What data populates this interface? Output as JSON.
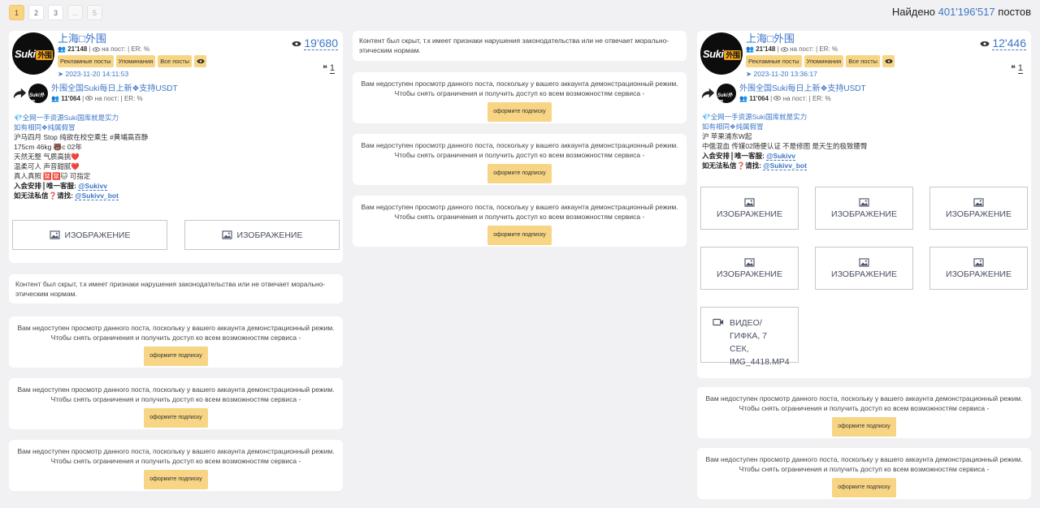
{
  "pagination": {
    "pages": [
      "1",
      "2",
      "3",
      "...",
      "5"
    ],
    "active": "1"
  },
  "found": {
    "prefix": "Найдено",
    "count": "401'196'517",
    "suffix": "постов"
  },
  "hidden_text": "Контент был скрыт, т.к имеет признаки нарушения законодательства или не отвечает морально-этическим нормам.",
  "demo": {
    "line1": "Вам недоступен просмотр данного поста, поскольку у вашего аккаунта демонстрационный режим.",
    "line2": "Чтобы снять ограничения и получить доступ ко всем возможностям сервиса -",
    "button": "оформите подписку"
  },
  "tags": {
    "ads": "Рекламные посты",
    "mentions": "Упоминания",
    "all": "Все посты"
  },
  "media": {
    "image": "ИЗОБРАЖЕНИЕ",
    "video": "ВИДЕО/ ГИФКА, 7 СЕК, IMG_4418.MP4"
  },
  "post1": {
    "channel": "上海□外围",
    "subscribers": "21'148",
    "meta_rest": "на пост: | ER: %",
    "date": "2023-11-20 14:11:53",
    "views": "19'680",
    "quotes": "1",
    "forward": {
      "title": "外围全国Suki每日上新❖支持USDT",
      "subscribers": "11'064",
      "meta_rest": "на пост: | ER: %"
    },
    "lines": [
      "全网一手资源Suki国库就是实力",
      "如有相同❖纯属假冒",
      "沪马四月 Stop 纯欲在校空乘生 #黄埔高百静",
      "175cm 46kg 🐻c 02年",
      "天然无整 气质高挑❤️",
      "温柔可人 声音甜腻❤️",
      "真人真照 🈲🈲🐱 可指定"
    ],
    "contact1_label": "入会安排║唯一客服:",
    "contact1_link": "@Sukivv",
    "contact2_label": "如无法私信❓请找:",
    "contact2_link": "@Sukivv_bot"
  },
  "post3": {
    "channel": "上海□外围",
    "subscribers": "21'148",
    "meta_rest": "на пост: | ER: %",
    "date": "2023-11-20 13:36:17",
    "views": "12'446",
    "quotes": "1",
    "forward": {
      "title": "外围全国Suki每日上新❖支持USDT",
      "subscribers": "11'064",
      "meta_rest": "на пост: | ER: %"
    },
    "lines": [
      "全网一手资源Suki国库就是实力",
      "如有相同❖纯属假冒",
      "沪 苹果浦东W起",
      "中俄混血 传媒02随便认证  不是修图 是天生的极致腰臀"
    ],
    "contact1_label": "入会安排║唯一客服:",
    "contact1_link": "@Sukivv",
    "contact2_label": "如无法私信❓请找:",
    "contact2_link": "@Sukivv_bot"
  }
}
